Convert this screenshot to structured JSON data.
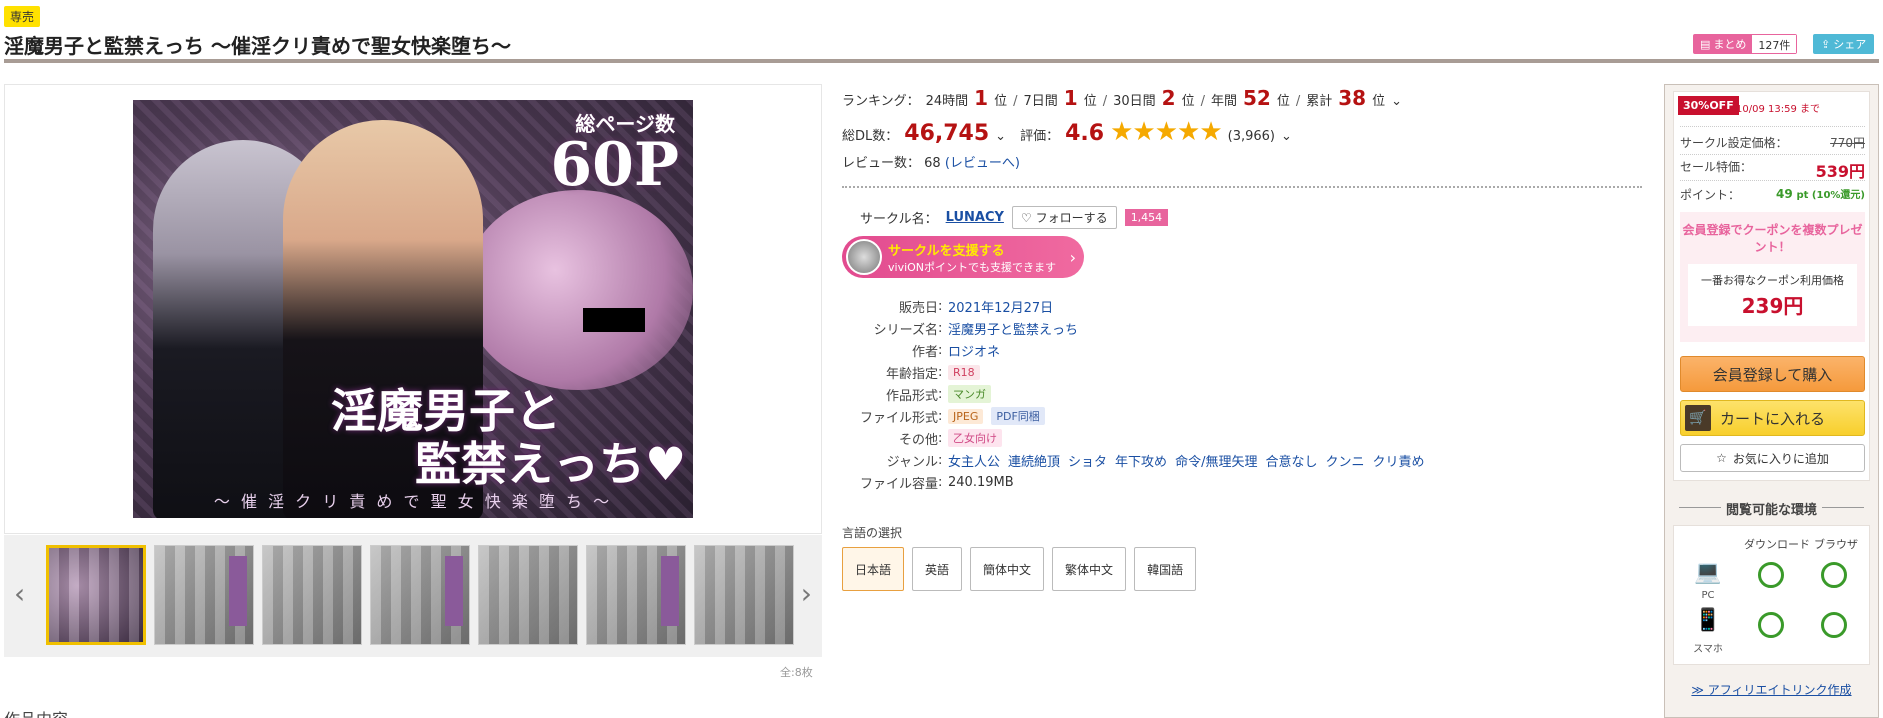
{
  "header": {
    "exclusive_badge": "専売",
    "title": "淫魔男子と監禁えっち ～催淫クリ責めで聖女快楽堕ち～",
    "matome_label": "まとめ",
    "matome_count": "127件",
    "share_label": "シェア"
  },
  "cover": {
    "pages_label": "総ページ数",
    "pages_value": "60P",
    "title_line1": "淫魔男子と",
    "title_line2": "監禁えっち♥",
    "subtitle": "～ 催 淫 ク リ 責 め で 聖 女 快 楽 堕 ち ～"
  },
  "thumbnails": {
    "count": 8,
    "count_label": "全:8枚",
    "prev_arrow": "‹",
    "next_arrow": "›"
  },
  "content_heading": "作品内容",
  "ranking": {
    "label": "ランキング：",
    "items": [
      {
        "period": "24時間",
        "rank": "1",
        "unit": "位"
      },
      {
        "period": "7日間",
        "rank": "1",
        "unit": "位"
      },
      {
        "period": "30日間",
        "rank": "2",
        "unit": "位"
      },
      {
        "period": "年間",
        "rank": "52",
        "unit": "位"
      },
      {
        "period": "累計",
        "rank": "38",
        "unit": "位"
      }
    ]
  },
  "stats": {
    "downloads_label": "総DL数：",
    "downloads_value": "46,745",
    "rating_label": "評価：",
    "rating_value": "4.6",
    "rating_stars": 4.6,
    "stars_text": "★★★★★",
    "rating_count": "(3,966)",
    "reviews_label": "レビュー数：",
    "reviews_count": "68",
    "reviews_link": "(レビューへ)"
  },
  "circle": {
    "label": "サークル名：",
    "name": "LUNACY",
    "follow_label": "フォローする",
    "follow_count": "1,454",
    "support_line1": "サークルを支援する",
    "support_line2": "viviONポイントでも支援できます"
  },
  "specs": {
    "release_label": "販売日",
    "release_value": "2021年12月27日",
    "series_label": "シリーズ名",
    "series_value": "淫魔男子と監禁えっち",
    "author_label": "作者",
    "author_value": "ロジオネ",
    "age_label": "年齢指定",
    "age_value": "R18",
    "format_label": "作品形式",
    "format_value": "マンガ",
    "file_label": "ファイル形式",
    "file_values": [
      "JPEG",
      "PDF同梱"
    ],
    "other_label": "その他",
    "other_value": "乙女向け",
    "genre_label": "ジャンル",
    "genres": [
      "女主人公",
      "連続絶頂",
      "ショタ",
      "年下攻め",
      "命令/無理矢理",
      "合意なし",
      "クンニ",
      "クリ責め"
    ],
    "size_label": "ファイル容量",
    "size_value": "240.19MB"
  },
  "language": {
    "label": "言語の選択",
    "options": [
      "日本語",
      "英語",
      "簡体中文",
      "繁体中文",
      "韓国語"
    ],
    "selected": "日本語"
  },
  "purchase": {
    "off_badge": "30%OFF",
    "off_until": "10/09 13:59 まで",
    "list_price_label": "サークル設定価格：",
    "list_price": "770円",
    "sale_price_label": "セール特価：",
    "sale_price": "539円",
    "point_label": "ポイント：",
    "point_value": "49",
    "point_suffix": "pt (10%還元)",
    "coupon_head": "会員登録でクーポンを複数プレゼント！",
    "coupon_price_label": "一番お得なクーポン利用価格",
    "coupon_price": "239円",
    "register_button": "会員登録して購入",
    "cart_button": "カートに入れる",
    "favorite_button": "お気に入りに追加"
  },
  "environment": {
    "title": "閲覧可能な環境",
    "col_download": "ダウンロード",
    "col_browser": "ブラウザ",
    "pc_label": "PC",
    "phone_label": "スマホ",
    "pc_download": true,
    "pc_browser": true,
    "phone_download": true,
    "phone_browser": true
  },
  "affiliate_link": "≫ アフィリエイトリンク作成",
  "colors": {
    "accent_red": "#b51212",
    "link_blue": "#1a4fa3",
    "pink": "#e8649d",
    "yellow_badge": "#ffe100"
  }
}
